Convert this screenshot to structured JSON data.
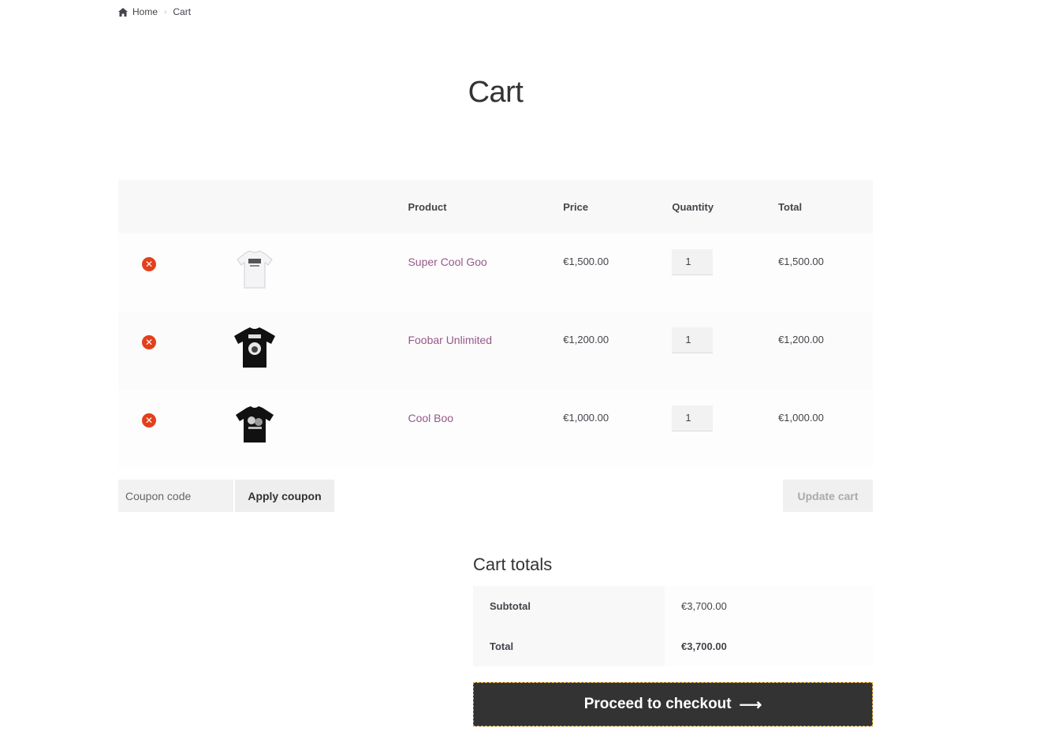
{
  "breadcrumb": {
    "home": "Home",
    "current": "Cart"
  },
  "page": {
    "title": "Cart"
  },
  "cart_table": {
    "headers": {
      "product": "Product",
      "price": "Price",
      "quantity": "Quantity",
      "total": "Total"
    },
    "items": [
      {
        "name": "Super Cool Goo",
        "price": "€1,500.00",
        "quantity": "1",
        "total": "€1,500.00",
        "shirt_color": "#f4f4f6"
      },
      {
        "name": "Foobar Unlimited",
        "price": "€1,200.00",
        "quantity": "1",
        "total": "€1,200.00",
        "shirt_color": "#111111"
      },
      {
        "name": "Cool Boo",
        "price": "€1,000.00",
        "quantity": "1",
        "total": "€1,000.00",
        "shirt_color": "#111111"
      }
    ]
  },
  "actions": {
    "coupon_placeholder": "Coupon code",
    "apply_coupon": "Apply coupon",
    "update_cart": "Update cart"
  },
  "totals": {
    "title": "Cart totals",
    "subtotal_label": "Subtotal",
    "subtotal_value": "€3,700.00",
    "total_label": "Total",
    "total_value": "€3,700.00"
  },
  "checkout": {
    "label": "Proceed to checkout",
    "arrow": "⟶"
  },
  "colors": {
    "link": "#96588a",
    "remove": "#e2401c",
    "checkout_bg": "#333333"
  },
  "icons": {
    "home": "home-icon",
    "remove": "remove-icon",
    "arrow": "arrow-right-icon"
  }
}
